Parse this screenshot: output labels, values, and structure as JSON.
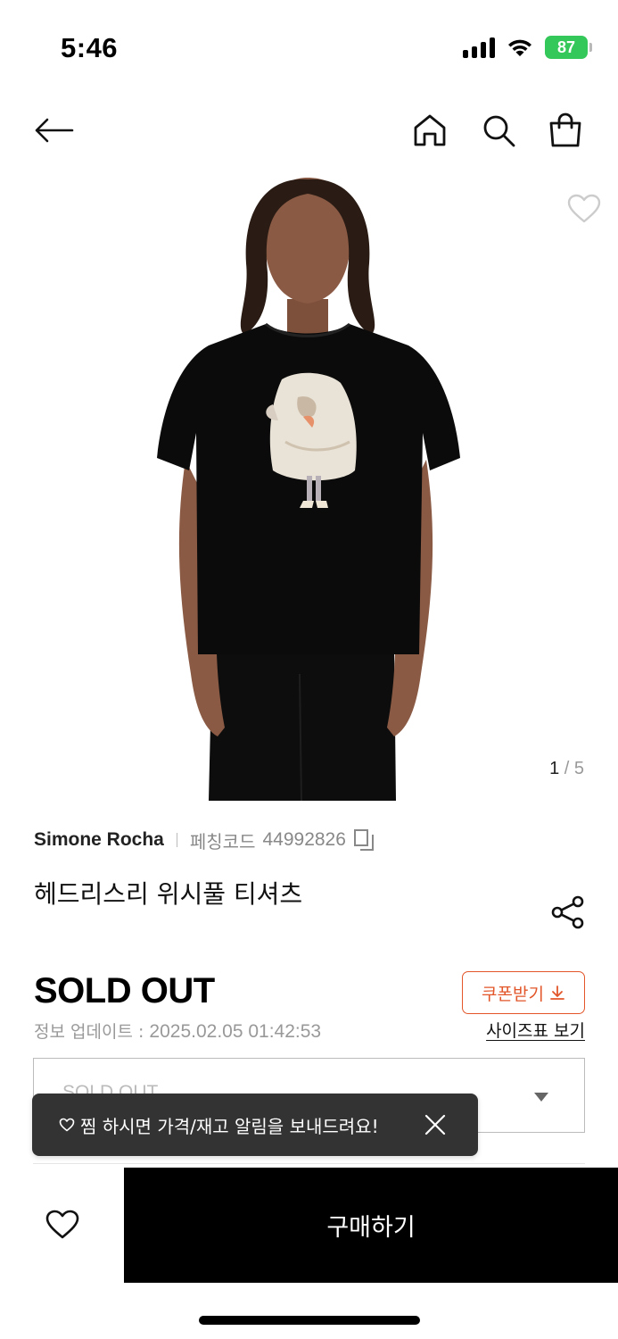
{
  "status_bar": {
    "time": "5:46",
    "battery": "87",
    "icons": [
      "signal-icon",
      "wifi-icon",
      "battery-icon"
    ]
  },
  "nav": {
    "icons": [
      "back-arrow-icon",
      "home-icon",
      "search-icon",
      "shopping-bag-icon"
    ]
  },
  "gallery": {
    "current": "1",
    "separator": " / ",
    "total": "5",
    "wish_icon": "heart-outline-icon"
  },
  "product": {
    "brand": "Simone Rocha",
    "code_label": "페칭코드",
    "code": "44992826",
    "title": "헤드리스리 위시풀 티셔츠",
    "price": "SOLD OUT",
    "update_label": "정보 업데이트 : ",
    "update_time": "2025.02.05 01:42:53"
  },
  "actions": {
    "coupon_label": "쿠폰받기",
    "size_chart_label": "사이즈표 보기",
    "option_value": "SOLD OUT",
    "buy_label": "구매하기"
  },
  "toast": {
    "message": "찜 하시면 가격/재고 알림을 보내드려요!"
  },
  "colors": {
    "accent": "#e2562a",
    "battery": "#34c759",
    "buy_button": "#000000",
    "toast_bg": "#333333"
  }
}
